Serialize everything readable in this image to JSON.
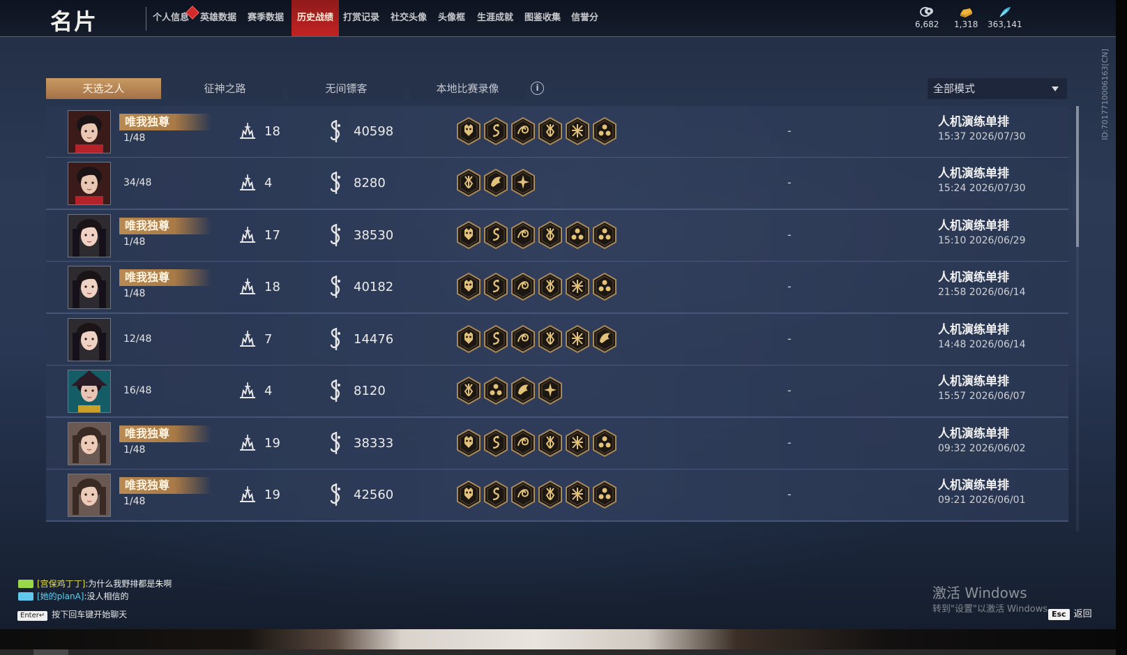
{
  "header": {
    "title": "名片",
    "nav": [
      {
        "label": "个人信息",
        "active": false,
        "badge": true
      },
      {
        "label": "英雄数据",
        "active": false
      },
      {
        "label": "赛季数据",
        "active": false
      },
      {
        "label": "历史战绩",
        "active": true
      },
      {
        "label": "打赏记录",
        "active": false
      },
      {
        "label": "社交头像",
        "active": false
      },
      {
        "label": "头像框",
        "active": false
      },
      {
        "label": "生涯成就",
        "active": false
      },
      {
        "label": "图鉴收集",
        "active": false
      },
      {
        "label": "信誉分",
        "active": false
      }
    ],
    "currencies": [
      {
        "icon": "coin-stack-icon",
        "value": "6,682"
      },
      {
        "icon": "gold-ingot-icon",
        "value": "1,318"
      },
      {
        "icon": "feather-icon",
        "value": "363,141"
      }
    ]
  },
  "tabs": [
    {
      "label": "天选之人",
      "active": true
    },
    {
      "label": "征神之路",
      "active": false
    },
    {
      "label": "无间镖客",
      "active": false
    },
    {
      "label": "本地比赛录像",
      "active": false
    }
  ],
  "mode_select": {
    "value": "全部模式"
  },
  "matches": [
    {
      "title": "唯我独尊",
      "rank": "1/48",
      "kills": "18",
      "score": "40598",
      "hexes": [
        "demon-hex-icon",
        "dragon-hex-icon",
        "swirl-hex-icon",
        "flame-hex-icon",
        "cross-hex-icon",
        "tri-hex-icon"
      ],
      "dash": "-",
      "mode": "人机演练单排",
      "time": "15:37  2026/07/30",
      "avatar": "male"
    },
    {
      "title": "",
      "rank": "34/48",
      "kills": "4",
      "score": "8280",
      "hexes": [
        "flame-hex-icon",
        "phoenix-hex-icon",
        "star-hex-icon"
      ],
      "dash": "-",
      "mode": "人机演练单排",
      "time": "15:24  2026/07/30",
      "avatar": "male"
    },
    {
      "title": "唯我独尊",
      "rank": "1/48",
      "kills": "17",
      "score": "38530",
      "hexes": [
        "demon-hex-icon",
        "dragon-hex-icon",
        "swirl-hex-icon",
        "flame-hex-icon",
        "tri-hex-icon",
        "tri-hex-icon"
      ],
      "dash": "-",
      "mode": "人机演练单排",
      "time": "15:10  2026/06/29",
      "avatar": "female"
    },
    {
      "title": "唯我独尊",
      "rank": "1/48",
      "kills": "18",
      "score": "40182",
      "hexes": [
        "demon-hex-icon",
        "dragon-hex-icon",
        "swirl-hex-icon",
        "flame-hex-icon",
        "cross-hex-icon",
        "tri-hex-icon"
      ],
      "dash": "-",
      "mode": "人机演练单排",
      "time": "21:58  2026/06/14",
      "avatar": "female"
    },
    {
      "title": "",
      "rank": "12/48",
      "kills": "7",
      "score": "14476",
      "hexes": [
        "demon-hex-icon",
        "dragon-hex-icon",
        "swirl-hex-icon",
        "flame-hex-icon",
        "cross-hex-icon",
        "phoenix-hex-icon"
      ],
      "dash": "-",
      "mode": "人机演练单排",
      "time": "14:48  2026/06/14",
      "avatar": "female"
    },
    {
      "title": "",
      "rank": "16/48",
      "kills": "4",
      "score": "8120",
      "hexes": [
        "flame-hex-icon",
        "tri-hex-icon",
        "phoenix-hex-icon",
        "star-hex-icon"
      ],
      "dash": "-",
      "mode": "人机演练单排",
      "time": "15:57  2026/06/07",
      "avatar": "witch"
    },
    {
      "title": "唯我独尊",
      "rank": "1/48",
      "kills": "19",
      "score": "38333",
      "hexes": [
        "demon-hex-icon",
        "dragon-hex-icon",
        "swirl-hex-icon",
        "flame-hex-icon",
        "cross-hex-icon",
        "tri-hex-icon"
      ],
      "dash": "-",
      "mode": "人机演练单排",
      "time": "09:32  2026/06/02",
      "avatar": "lady"
    },
    {
      "title": "唯我独尊",
      "rank": "1/48",
      "kills": "19",
      "score": "42560",
      "hexes": [
        "demon-hex-icon",
        "dragon-hex-icon",
        "swirl-hex-icon",
        "flame-hex-icon",
        "cross-hex-icon",
        "tri-hex-icon"
      ],
      "dash": "-",
      "mode": "人机演练单排",
      "time": "09:21  2026/06/01",
      "avatar": "lady"
    }
  ],
  "side_id": "ID:7017710006163[CN]",
  "chat": [
    {
      "name": "[宫保鸡丁丁]",
      "text": ":为什么我野排都是朱啊",
      "icon": "team-icon"
    },
    {
      "name": "[她的planA]",
      "text": ":没人相信的",
      "icon": "friend-icon"
    }
  ],
  "enter_hint": {
    "key": "Enter↵",
    "text": "按下回车键开始聊天"
  },
  "watermark": {
    "line1": "激活 Windows",
    "line2": "转到\"设置\"以激活 Windows。"
  },
  "back": {
    "key": "Esc",
    "label": "返回"
  }
}
